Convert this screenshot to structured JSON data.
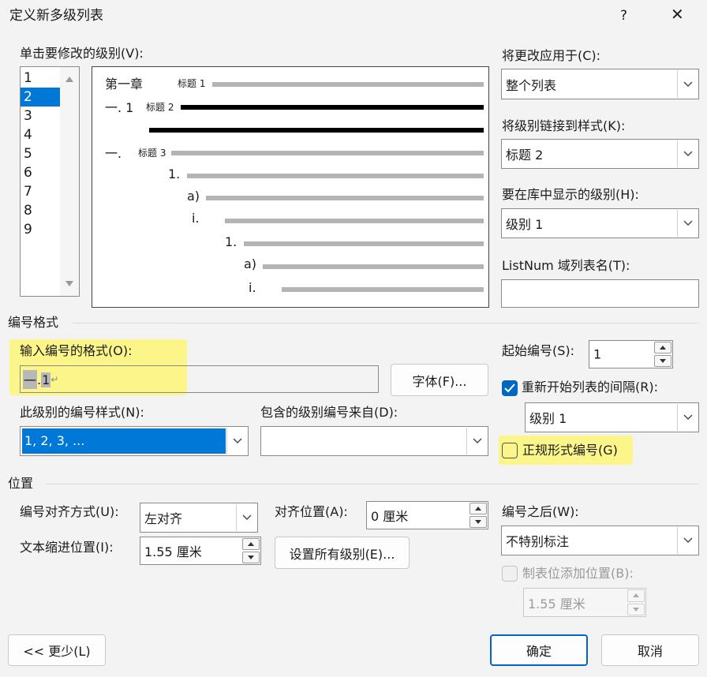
{
  "dialog": {
    "title": "定义新多级列表",
    "help": "?",
    "close": "✕"
  },
  "level_section": {
    "label": "单击要修改的级别(V):",
    "levels": [
      "1",
      "2",
      "3",
      "4",
      "5",
      "6",
      "7",
      "8",
      "9"
    ],
    "selected_index": 1
  },
  "preview": {
    "line1_num": "第一章",
    "line1_style": "标题 1",
    "line2_num": "一. 1",
    "line2_style": "标题 2",
    "line4_num": "一.",
    "line4_style": "标题 3",
    "line5_num": "1.",
    "line6_num": "a)",
    "line7_num": "i.",
    "line8_num": "1.",
    "line9_num": "a)",
    "line10_num": "i."
  },
  "apply_to": {
    "label": "将更改应用于(C):",
    "value": "整个列表"
  },
  "link_style": {
    "label": "将级别链接到样式(K):",
    "value": "标题 2"
  },
  "gallery_level": {
    "label": "要在库中显示的级别(H):",
    "value": "级别 1"
  },
  "listnum": {
    "label": "ListNum 域列表名(T):",
    "value": ""
  },
  "number_format": {
    "section": "编号格式",
    "input_label": "输入编号的格式(O):",
    "input_part1": "一",
    "input_part2": ".",
    "input_part3": "1",
    "para_mark": "↵",
    "font_button": "字体(F)...",
    "style_label": "此级别的编号样式(N):",
    "style_value": "1, 2, 3, ...",
    "include_label": "包含的级别编号来自(D):",
    "include_value": ""
  },
  "start_at": {
    "label": "起始编号(S):",
    "value": "1"
  },
  "restart": {
    "label": "重新开始列表的间隔(R):",
    "checked": true,
    "value": "级别 1"
  },
  "legal": {
    "label": "正规形式编号(G)",
    "checked": false
  },
  "position": {
    "section": "位置",
    "align_label": "编号对齐方式(U):",
    "align_value": "左对齐",
    "aligned_at_label": "对齐位置(A):",
    "aligned_at_value": "0 厘米",
    "indent_label": "文本缩进位置(I):",
    "indent_value": "1.55 厘米",
    "set_all_button": "设置所有级别(E)...",
    "follow_label": "编号之后(W):",
    "follow_value": "不特别标注",
    "tab_label": "制表位添加位置(B):",
    "tab_value": "1.55 厘米"
  },
  "footer": {
    "less_button": "<< 更少(L)",
    "ok_button": "确定",
    "cancel_button": "取消"
  },
  "colors": {
    "accent": "#0067c0",
    "highlight": "#fbf58a",
    "selection": "#0078d7"
  }
}
